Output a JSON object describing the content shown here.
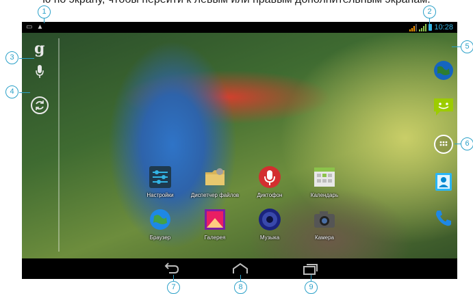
{
  "caption": {
    "text": "ю по экрану, чтобы перейти к левым или правым дополнительным экранам."
  },
  "status_bar": {
    "time": "10:28",
    "left_icons": [
      "screenshot-icon",
      "warning-icon"
    ],
    "right_icons": [
      "signal-icon",
      "signal-icon",
      "battery-icon"
    ]
  },
  "left_panel": {
    "google_search_icon": "google-search-icon",
    "google_letter": "g",
    "voice_search_icon": "microphone-icon",
    "sync_icon": "sync-icon"
  },
  "apps": [
    {
      "label": "Настройки",
      "icon": "settings-icon",
      "color": "#1e3a4e"
    },
    {
      "label": "Диспетчер файлов",
      "icon": "file-manager-icon",
      "color": "#d8b45a"
    },
    {
      "label": "Диктофон",
      "icon": "voice-recorder-icon",
      "color": "#d32f2f"
    },
    {
      "label": "Календарь",
      "icon": "calendar-icon",
      "color": "#8bc34a"
    },
    {
      "label": "Браузер",
      "icon": "browser-icon",
      "color": "#1e88e5"
    },
    {
      "label": "Галерея",
      "icon": "gallery-icon",
      "color": "#7b1fa2"
    },
    {
      "label": "Музыка",
      "icon": "music-icon",
      "color": "#1a237e"
    },
    {
      "label": "Камера",
      "icon": "camera-icon",
      "color": "#555555"
    }
  ],
  "right_dock": [
    {
      "icon": "browser-globe-icon"
    },
    {
      "icon": "messaging-icon"
    },
    {
      "icon": "all-apps-icon"
    },
    {
      "icon": "contacts-icon"
    },
    {
      "icon": "phone-icon"
    }
  ],
  "nav_bar": {
    "buttons": [
      "back-icon",
      "home-icon",
      "recent-apps-icon"
    ]
  },
  "callouts": [
    "1",
    "2",
    "3",
    "4",
    "5",
    "6",
    "7",
    "8",
    "9"
  ],
  "colors": {
    "callout": "#2aa0c8",
    "status_accent": "#33b5e5",
    "bar_background": "#000000"
  }
}
